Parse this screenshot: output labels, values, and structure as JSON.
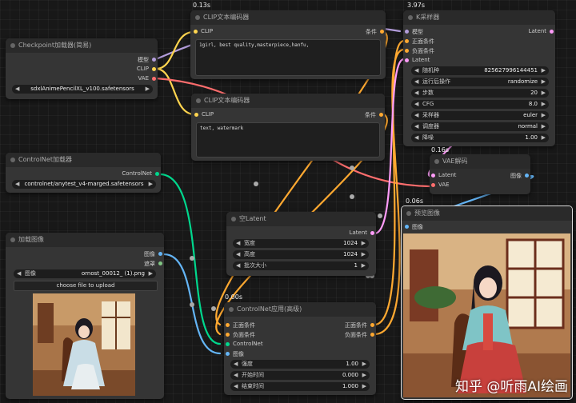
{
  "colors": {
    "model": "#b39ddb",
    "clip": "#ffd54f",
    "vae": "#ff6e6e",
    "conditioning": "#ffa931",
    "latent": "#ff9cf9",
    "image": "#64b5f6",
    "mask": "#81c784",
    "controlnet": "#00d78d"
  },
  "timings": {
    "clip_top": "0.13s",
    "ksampler": "3.97s",
    "vae_decode": "0.16s",
    "preview": "0.06s",
    "controlnet_apply": "0.00s"
  },
  "checkpoint": {
    "title": "Checkpoint加载器(简易)",
    "out_model": "模型",
    "out_clip": "CLIP",
    "out_vae": "VAE",
    "ckpt_value": "sdxlAnimePencilXL_v100.safetensors"
  },
  "clip1": {
    "title": "CLIP文本编码器",
    "in_clip": "CLIP",
    "out_cond": "条件",
    "text": "1girl, best quality,masterpiece,hanfu,"
  },
  "clip2": {
    "title": "CLIP文本编码器",
    "in_clip": "CLIP",
    "out_cond": "条件",
    "text": "text, watermark"
  },
  "ksampler": {
    "title": "K采样器",
    "in_model": "模型",
    "in_pos": "正面条件",
    "in_neg": "负面条件",
    "in_latent": "Latent",
    "out_latent": "Latent",
    "widgets": [
      {
        "label": "随机种",
        "value": "825627996144451"
      },
      {
        "label": "运行后操作",
        "value": "randomize"
      },
      {
        "label": "步数",
        "value": "20"
      },
      {
        "label": "CFG",
        "value": "8.0"
      },
      {
        "label": "采样器",
        "value": "euler"
      },
      {
        "label": "调度器",
        "value": "normal"
      },
      {
        "label": "降噪",
        "value": "1.00"
      }
    ]
  },
  "vae_decode": {
    "title": "VAE解码",
    "in_latent": "Latent",
    "in_vae": "VAE",
    "out_image": "图像"
  },
  "controlnet_loader": {
    "title": "ControlNet加载器",
    "out_controlnet": "ControlNet",
    "value": "controlnet/anytest_v4-marged.safetensors"
  },
  "empty_latent": {
    "title": "空Latent",
    "out_latent": "Latent",
    "widgets": [
      {
        "label": "宽度",
        "value": "1024"
      },
      {
        "label": "高度",
        "value": "1024"
      },
      {
        "label": "批次大小",
        "value": "1"
      }
    ]
  },
  "load_image": {
    "title": "加载图像",
    "out_image": "图像",
    "out_mask": "遮罩",
    "image_label": "图像",
    "image_value": "ornost_00012_ (1).png",
    "upload_label": "choose file to upload"
  },
  "controlnet_apply": {
    "title": "ControlNet应用(高级)",
    "in_pos": "正面条件",
    "in_neg": "负面条件",
    "in_controlnet": "ControlNet",
    "in_image": "图像",
    "out_pos": "正面条件",
    "out_neg": "负面条件",
    "widgets": [
      {
        "label": "强度",
        "value": "1.00"
      },
      {
        "label": "开始时间",
        "value": "0.000"
      },
      {
        "label": "结束时间",
        "value": "1.000"
      }
    ]
  },
  "preview": {
    "title": "预览图像",
    "in_image": "图像"
  },
  "watermark": "知乎 @听雨AI绘画"
}
